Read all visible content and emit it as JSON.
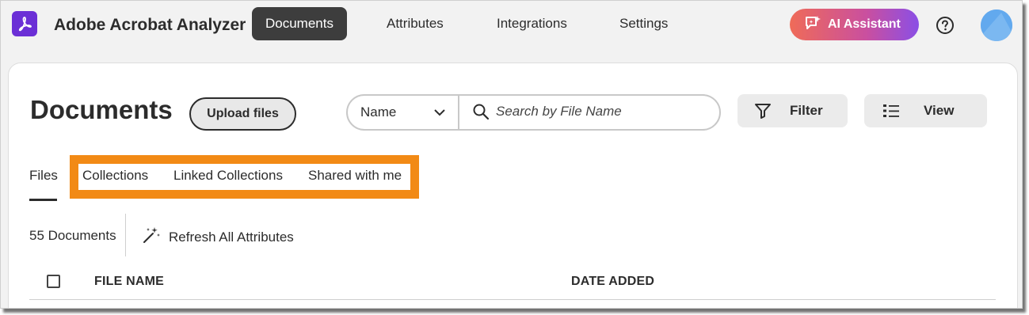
{
  "app": {
    "name": "Adobe Acrobat Analyzer",
    "brand_color": "#6b2fd6"
  },
  "nav": {
    "items": [
      {
        "label": "Documents",
        "active": true
      },
      {
        "label": "Attributes",
        "active": false
      },
      {
        "label": "Integrations",
        "active": false
      },
      {
        "label": "Settings",
        "active": false
      }
    ],
    "ai_assistant_label": "AI Assistant",
    "help_icon": "help-circle-icon",
    "avatar_color": "#62a9ee"
  },
  "page": {
    "title": "Documents",
    "upload_label": "Upload files"
  },
  "search": {
    "field_select_value": "Name",
    "placeholder": "Search by File Name"
  },
  "toolbar": {
    "filter_label": "Filter",
    "view_label": "View"
  },
  "tabs": [
    {
      "label": "Files",
      "active": true
    },
    {
      "label": "Collections",
      "active": false
    },
    {
      "label": "Linked Collections",
      "active": false
    },
    {
      "label": "Shared with me",
      "active": false
    }
  ],
  "highlight_color": "#f28a15",
  "summary": {
    "doc_count": "55 Documents",
    "refresh_label": "Refresh All Attributes"
  },
  "table": {
    "columns": [
      "FILE NAME",
      "DATE ADDED"
    ]
  }
}
